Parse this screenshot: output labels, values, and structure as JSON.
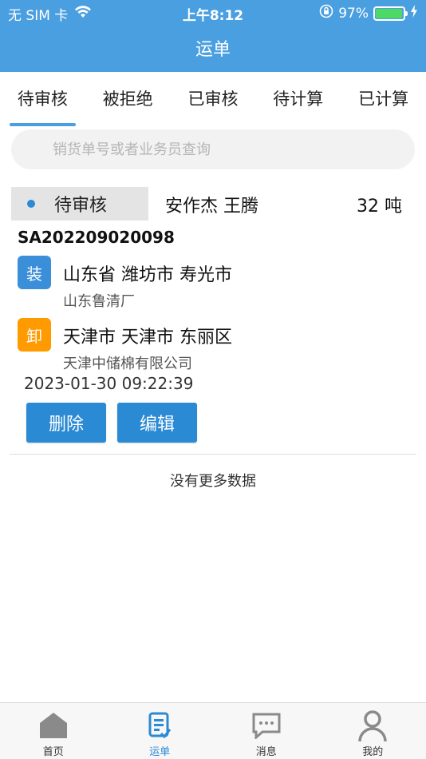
{
  "status_bar": {
    "carrier": "无 SIM 卡",
    "time": "上午8:12",
    "battery_percent": "97%",
    "battery_level": 0.97
  },
  "header": {
    "title": "运单"
  },
  "tabs": [
    {
      "label": "待审核",
      "active": true
    },
    {
      "label": "被拒绝",
      "active": false
    },
    {
      "label": "已审核",
      "active": false
    },
    {
      "label": "待计算",
      "active": false
    },
    {
      "label": "已计算",
      "active": false
    }
  ],
  "search": {
    "placeholder": "销货单号或者业务员查询",
    "value": ""
  },
  "order": {
    "status": "待审核",
    "names": "安作杰  王腾",
    "weight": "32 吨",
    "order_no": "SA202209020098",
    "load": {
      "badge": "装",
      "address": "山东省 潍坊市 寿光市",
      "company": "山东鲁清厂"
    },
    "unload": {
      "badge": "卸",
      "address": "天津市 天津市 东丽区",
      "company": "天津中储棉有限公司"
    },
    "datetime": "2023-01-30 09:22:39",
    "delete_label": "删除",
    "edit_label": "编辑"
  },
  "footer_text": "没有更多数据",
  "colors": {
    "primary": "#4a9fe0",
    "button": "#2a8ad4",
    "load_badge": "#3a8fd8",
    "unload_badge": "#ff9a00"
  },
  "bottom_nav": [
    {
      "label": "首页",
      "icon": "home-icon",
      "active": false
    },
    {
      "label": "运单",
      "icon": "waybill-icon",
      "active": true
    },
    {
      "label": "消息",
      "icon": "message-icon",
      "active": false
    },
    {
      "label": "我的",
      "icon": "profile-icon",
      "active": false
    }
  ]
}
